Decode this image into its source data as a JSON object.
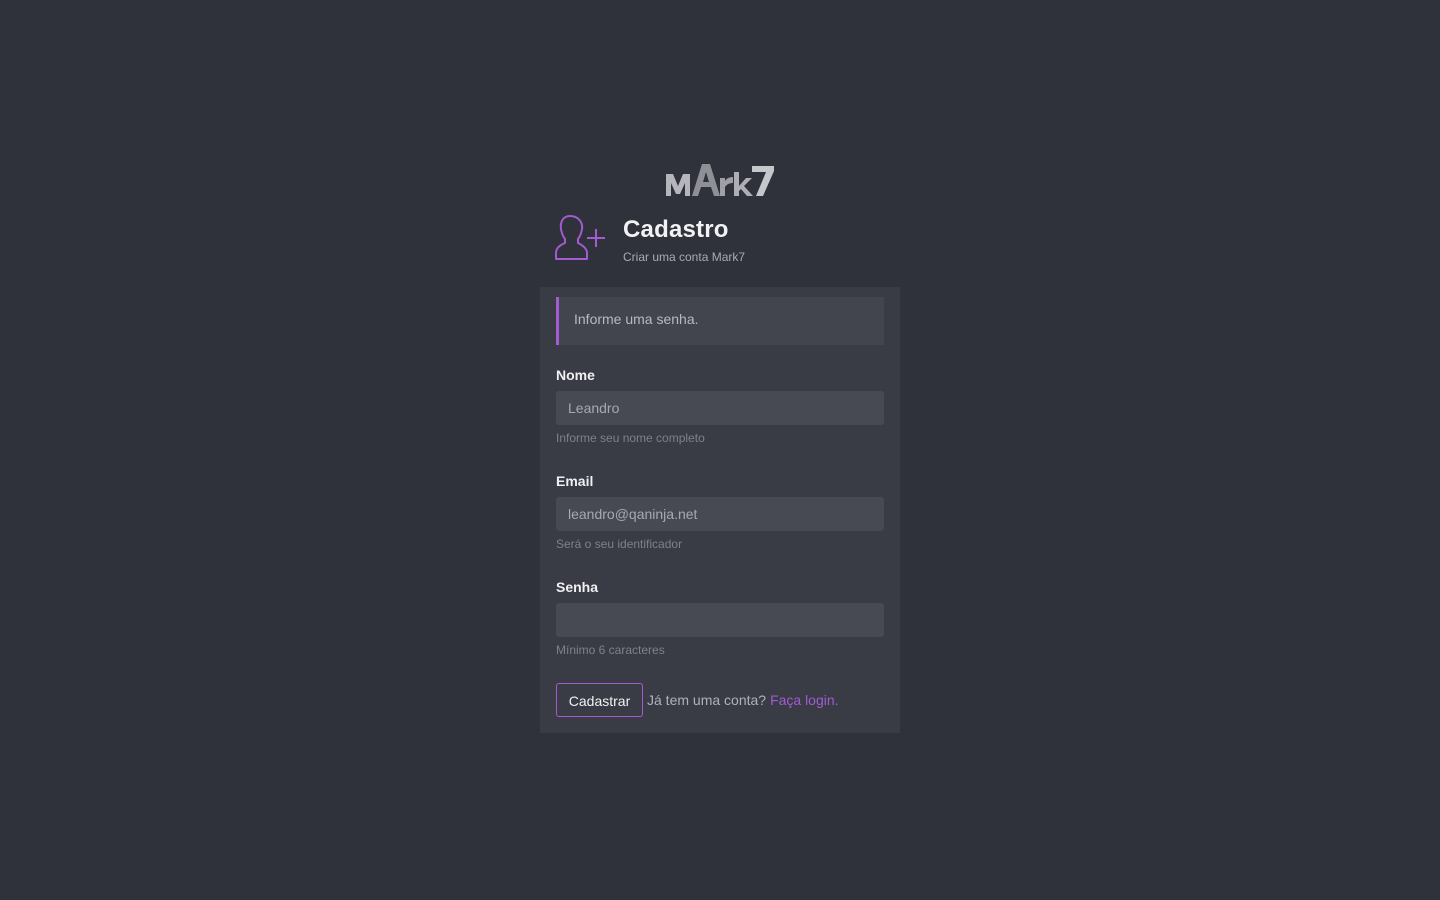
{
  "brand": {
    "logo_text": "MArk7",
    "accent_color": "#a25bd1"
  },
  "header": {
    "icon": "add-user-icon",
    "title": "Cadastro",
    "subtitle": "Criar uma conta Mark7"
  },
  "alert": {
    "message": "Informe uma senha."
  },
  "form": {
    "name": {
      "label": "Nome",
      "value": "Leandro",
      "help": "Informe seu nome completo"
    },
    "email": {
      "label": "Email",
      "value": "leandro@qaninja.net",
      "help": "Será o seu identificador"
    },
    "password": {
      "label": "Senha",
      "value": "",
      "help": "Mínimo 6 caracteres"
    }
  },
  "actions": {
    "submit_label": "Cadastrar",
    "login_question": "Já tem uma conta?",
    "login_link": "Faça login."
  }
}
